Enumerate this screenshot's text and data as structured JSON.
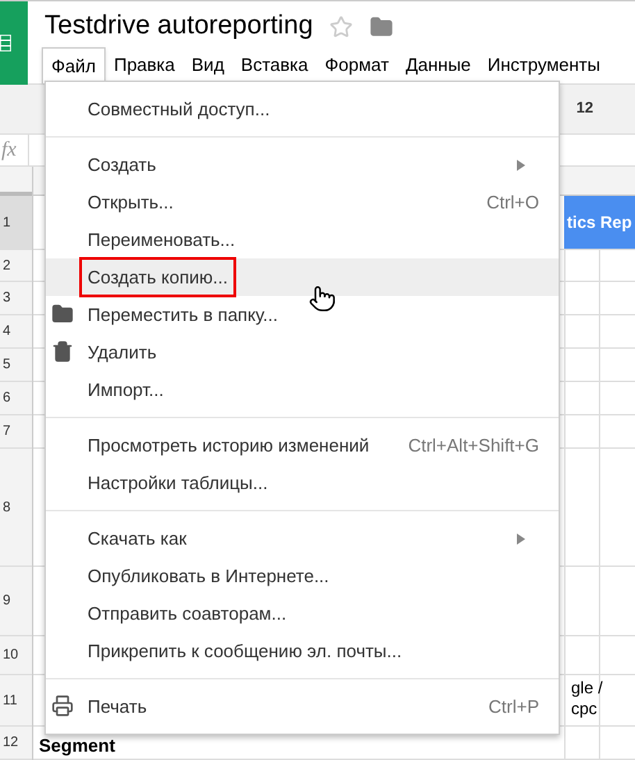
{
  "document": {
    "title": "Testdrive autoreporting",
    "starred": false
  },
  "menubar": [
    {
      "label": "Файл",
      "selected": true
    },
    {
      "label": "Правка",
      "selected": false
    },
    {
      "label": "Вид",
      "selected": false
    },
    {
      "label": "Вставка",
      "selected": false
    },
    {
      "label": "Формат",
      "selected": false
    },
    {
      "label": "Данные",
      "selected": false
    },
    {
      "label": "Инструменты",
      "selected": false
    }
  ],
  "toolbar": {
    "font_size": "12"
  },
  "formula_bar": {
    "label": "fx"
  },
  "sheet": {
    "rows": [
      {
        "number": "1",
        "selected": true
      },
      {
        "number": "2",
        "selected": false
      },
      {
        "number": "3",
        "selected": false
      },
      {
        "number": "4",
        "selected": false
      },
      {
        "number": "5",
        "selected": false
      },
      {
        "number": "6",
        "selected": false
      },
      {
        "number": "7",
        "selected": false
      },
      {
        "number": "8",
        "selected": false
      },
      {
        "number": "9",
        "selected": false
      },
      {
        "number": "10",
        "selected": false
      },
      {
        "number": "11",
        "selected": false
      },
      {
        "number": "12",
        "selected": false
      }
    ],
    "header_cell": "tics Rep",
    "source_cell": "gle /\ncpc",
    "segment_cell": "Segment"
  },
  "file_menu": [
    {
      "kind": "item",
      "label": "Совместный доступ...",
      "selected": false,
      "outlined": false,
      "submenu": false
    },
    {
      "kind": "separator"
    },
    {
      "kind": "item",
      "label": "Создать",
      "selected": false,
      "outlined": false,
      "submenu": true
    },
    {
      "kind": "item",
      "label": "Открыть...",
      "shortcut": "Ctrl+O",
      "selected": false,
      "outlined": false,
      "submenu": false
    },
    {
      "kind": "item",
      "label": "Переименовать...",
      "selected": false,
      "outlined": false,
      "submenu": false
    },
    {
      "kind": "item",
      "label": "Создать копию...",
      "selected": true,
      "outlined": true,
      "submenu": false
    },
    {
      "kind": "item",
      "label": "Переместить в папку...",
      "selected": false,
      "outlined": false,
      "submenu": false
    },
    {
      "kind": "item",
      "label": "Удалить",
      "selected": false,
      "outlined": false,
      "submenu": false
    },
    {
      "kind": "item",
      "label": "Импорт...",
      "selected": false,
      "outlined": false,
      "submenu": false
    },
    {
      "kind": "separator"
    },
    {
      "kind": "item",
      "label": "Просмотреть историю изменений",
      "shortcut": "Ctrl+Alt+Shift+G",
      "selected": false,
      "outlined": false,
      "submenu": false
    },
    {
      "kind": "item",
      "label": "Настройки таблицы...",
      "selected": false,
      "outlined": false,
      "submenu": false
    },
    {
      "kind": "separator"
    },
    {
      "kind": "item",
      "label": "Скачать как",
      "selected": false,
      "outlined": false,
      "submenu": true
    },
    {
      "kind": "item",
      "label": "Опубликовать в Интернете...",
      "selected": false,
      "outlined": false,
      "submenu": false
    },
    {
      "kind": "item",
      "label": "Отправить соавторам...",
      "selected": false,
      "outlined": false,
      "submenu": false
    },
    {
      "kind": "item",
      "label": "Прикрепить к сообщению эл. почты...",
      "selected": false,
      "outlined": false,
      "submenu": false
    },
    {
      "kind": "separator"
    },
    {
      "kind": "item",
      "label": "Печать",
      "shortcut": "Ctrl+P",
      "selected": false,
      "outlined": false,
      "submenu": false
    }
  ]
}
